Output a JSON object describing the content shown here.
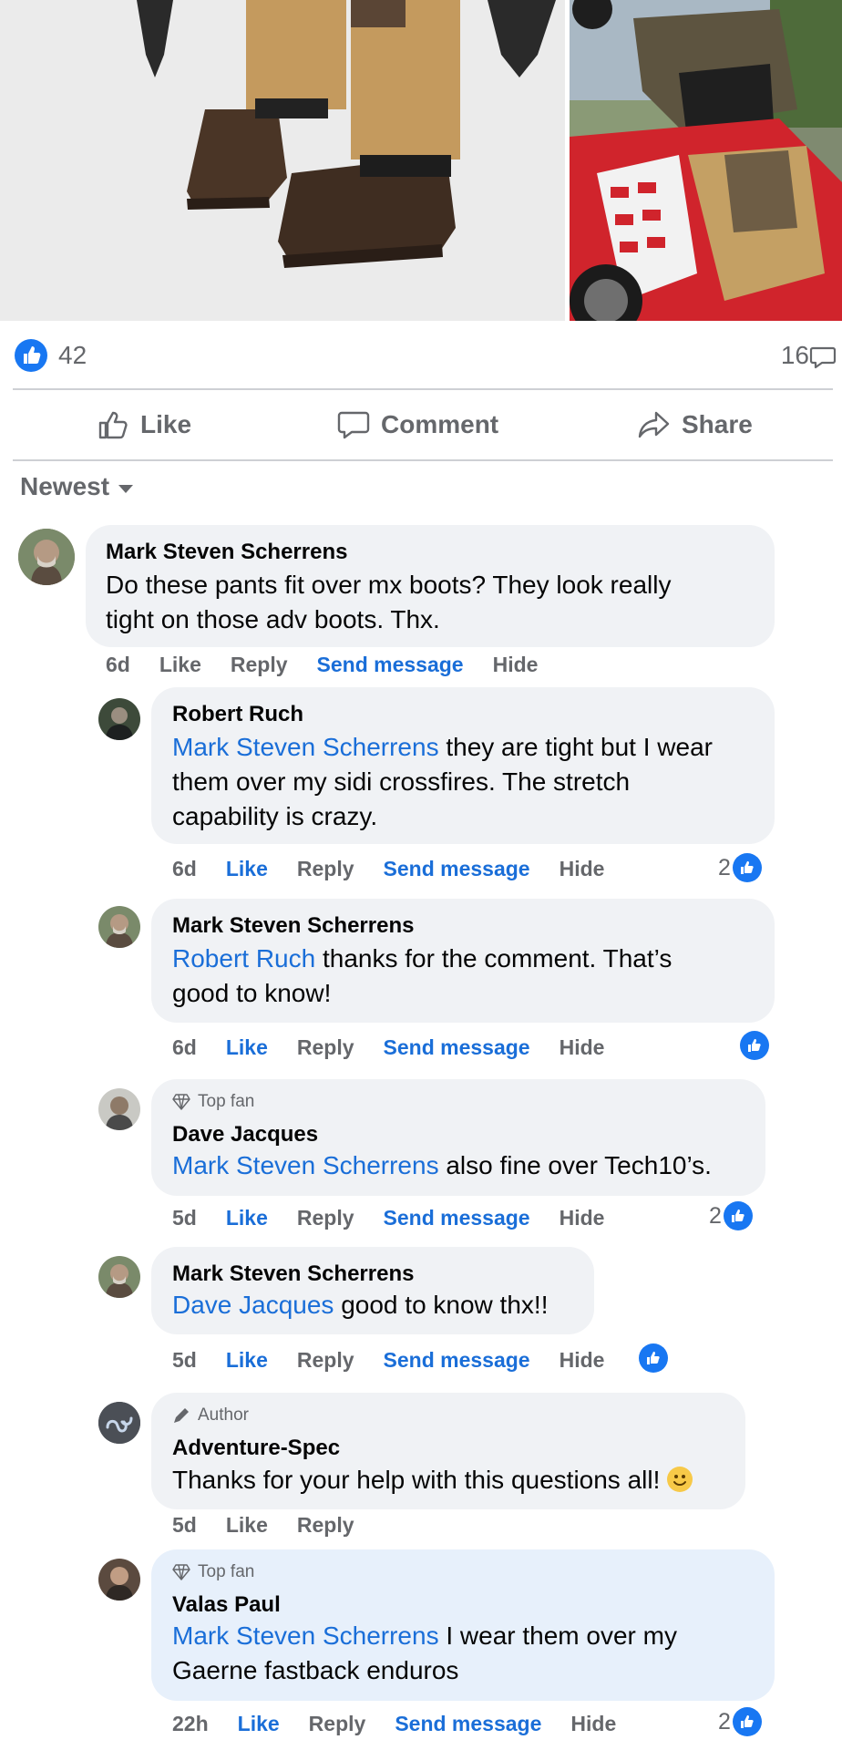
{
  "post": {
    "like_count": "42",
    "comment_count": "16"
  },
  "actions": {
    "like": "Like",
    "comment": "Comment",
    "share": "Share"
  },
  "sort": {
    "label": "Newest"
  },
  "meta_labels": {
    "like": "Like",
    "reply": "Reply",
    "send": "Send message",
    "hide": "Hide"
  },
  "comments": [
    {
      "name": "Mark Steven Scherrens",
      "badge": "",
      "mention": "",
      "line1": "Do these pants fit over mx boots? They look really",
      "line2": "tight on those adv boots. Thx.",
      "line3": "",
      "time": "6d",
      "liked": false,
      "reactions": ""
    },
    {
      "name": "Robert Ruch",
      "badge": "",
      "mention": "Mark Steven Scherrens",
      "line1": " they are tight but I wear",
      "line2": "them over my sidi crossfires. The stretch",
      "line3": "capability is crazy.",
      "time": "6d",
      "liked": true,
      "reactions": "2"
    },
    {
      "name": "Mark Steven Scherrens",
      "badge": "",
      "mention": "Robert Ruch",
      "line1": " thanks for the comment. That’s",
      "line2": "good to know!",
      "line3": "",
      "time": "6d",
      "liked": true,
      "reactions": ""
    },
    {
      "name": "Dave Jacques",
      "badge": "Top fan",
      "mention": "Mark Steven Scherrens",
      "line1": " also fine over Tech10’s.",
      "line2": "",
      "line3": "",
      "time": "5d",
      "liked": true,
      "reactions": "2"
    },
    {
      "name": "Mark Steven Scherrens",
      "badge": "",
      "mention": "Dave Jacques",
      "line1": " good to know thx!!",
      "line2": "",
      "line3": "",
      "time": "5d",
      "liked": true,
      "reactions": ""
    },
    {
      "name": "Adventure-Spec",
      "badge": "Author",
      "mention": "",
      "line1": "Thanks for your help with this questions all! ",
      "line2": "",
      "line3": "",
      "time": "5d",
      "liked": false,
      "reactions": ""
    },
    {
      "name": "Valas Paul",
      "badge": "Top fan",
      "mention": "Mark Steven Scherrens",
      "line1": " I wear them over my",
      "line2": "Gaerne fastback enduros",
      "line3": "",
      "time": "22h",
      "liked": true,
      "reactions": "2"
    }
  ]
}
